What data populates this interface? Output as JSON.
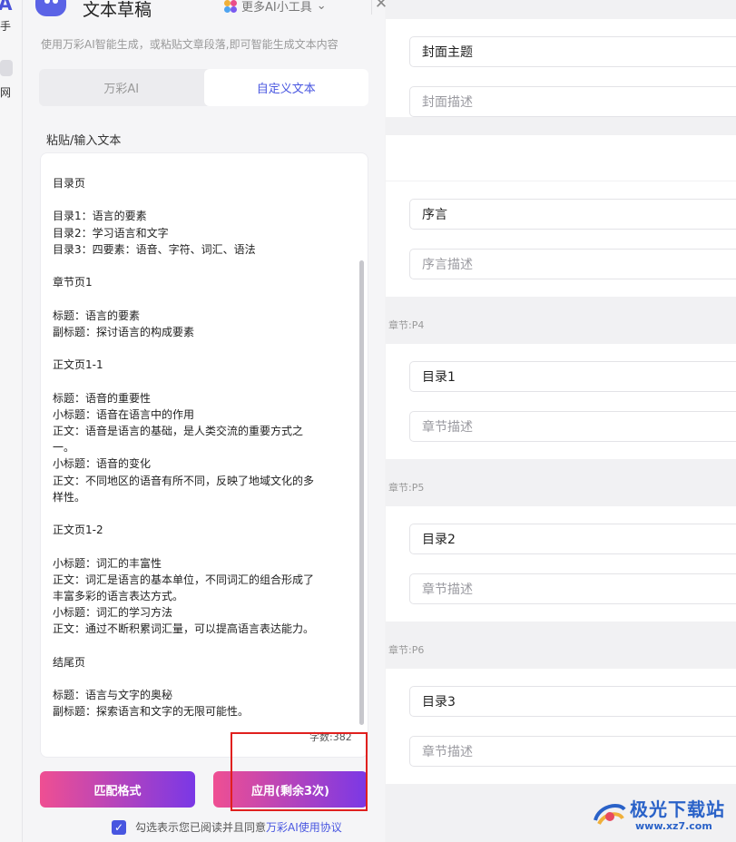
{
  "strip": {
    "label_top": "手",
    "label_bottom": "网"
  },
  "header": {
    "title": "文本草稿",
    "more_tools": "更多AI小工具",
    "subtitle": "使用万彩AI智能生成，或粘贴文章段落,即可智能生成文本内容"
  },
  "tabs": [
    {
      "label": "万彩AI",
      "active": false
    },
    {
      "label": "自定义文本",
      "active": true
    }
  ],
  "editor": {
    "label": "粘贴/输入文本",
    "lines": [
      "目录页",
      "",
      "目录1：语言的要素",
      "目录2：学习语言和文字",
      "目录3：四要素：语音、字符、词汇、语法",
      "",
      "章节页1",
      "",
      "标题：语言的要素",
      "副标题：探讨语言的构成要素",
      "",
      "正文页1-1",
      "",
      "标题：语音的重要性",
      "小标题：语音在语言中的作用",
      "正文：语音是语言的基础，是人类交流的重要方式之",
      "一。",
      "小标题：语音的变化",
      "正文：不同地区的语音有所不同，反映了地域文化的多",
      "样性。",
      "",
      "正文页1-2",
      "",
      "小标题：词汇的丰富性",
      "正文：词汇是语言的基本单位，不同词汇的组合形成了",
      "丰富多彩的语言表达方式。",
      "小标题：词汇的学习方法",
      "正文：通过不断积累词汇量，可以提高语言表达能力。",
      "",
      "结尾页",
      "",
      "标题：语言与文字的奥秘",
      "副标题：探索语言和文字的无限可能性。"
    ],
    "word_count": "字数:382"
  },
  "buttons": {
    "match": "匹配格式",
    "apply": "应用(剩余3次)"
  },
  "agreement": {
    "text": "勾选表示您已阅读并且同意",
    "link": "万彩AI使用协议",
    "checked": true
  },
  "outline": {
    "cover": {
      "title_value": "封面主题",
      "desc_placeholder": "封面描述"
    },
    "preface": {
      "title_value": "序言",
      "desc_placeholder": "序言描述"
    },
    "chapters": [
      {
        "label": "章节:P4",
        "title_value": "目录1",
        "desc_placeholder": "章节描述"
      },
      {
        "label": "章节:P5",
        "title_value": "目录2",
        "desc_placeholder": "章节描述"
      },
      {
        "label": "章节:P6",
        "title_value": "目录3",
        "desc_placeholder": "章节描述"
      }
    ]
  },
  "watermark": {
    "name": "极光下载站",
    "url": "www.xz7.com"
  },
  "colors": {
    "accent": "#4856e0",
    "gradient_start": "#ef4f92",
    "gradient_end": "#7a38e6",
    "highlight": "#e0201e"
  }
}
